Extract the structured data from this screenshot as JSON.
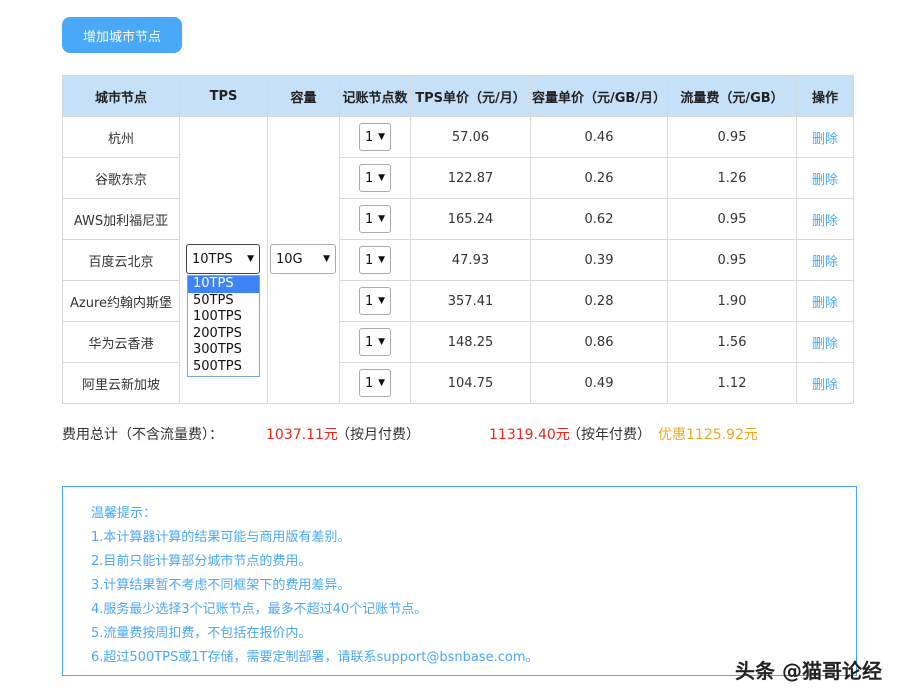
{
  "add_button": "增加城市节点",
  "table": {
    "headers": [
      "城市节点",
      "TPS",
      "容量",
      "记账节点数",
      "TPS单价（元/月）",
      "容量单价（元/GB/月）",
      "流量费（元/GB）",
      "操作"
    ],
    "rows": [
      {
        "city": "杭州",
        "count": "1",
        "tps_price": "57.06",
        "cap_price": "0.46",
        "traffic": "0.95",
        "action": "删除"
      },
      {
        "city": "谷歌东京",
        "count": "1",
        "tps_price": "122.87",
        "cap_price": "0.26",
        "traffic": "1.26",
        "action": "删除"
      },
      {
        "city": "AWS加利福尼亚",
        "count": "1",
        "tps_price": "165.24",
        "cap_price": "0.62",
        "traffic": "0.95",
        "action": "删除"
      },
      {
        "city": "百度云北京",
        "count": "1",
        "tps_price": "47.93",
        "cap_price": "0.39",
        "traffic": "0.95",
        "action": "删除"
      },
      {
        "city": "Azure约翰内斯堡",
        "count": "1",
        "tps_price": "357.41",
        "cap_price": "0.28",
        "traffic": "1.90",
        "action": "删除"
      },
      {
        "city": "华为云香港",
        "count": "1",
        "tps_price": "148.25",
        "cap_price": "0.86",
        "traffic": "1.56",
        "action": "删除"
      },
      {
        "city": "阿里云新加坡",
        "count": "1",
        "tps_price": "104.75",
        "cap_price": "0.49",
        "traffic": "1.12",
        "action": "删除"
      }
    ]
  },
  "tps_select": {
    "value": "10TPS",
    "options": [
      "10TPS",
      "50TPS",
      "100TPS",
      "200TPS",
      "300TPS",
      "500TPS"
    ]
  },
  "capacity_select": {
    "value": "10G"
  },
  "summary": {
    "label": "费用总计（不含流量费）：",
    "monthly_amount": "1037.11元",
    "monthly_note": "（按月付费）",
    "yearly_amount": "11319.40元",
    "yearly_note": "（按年付费）",
    "discount": "优惠1125.92元"
  },
  "tips": {
    "title": "温馨提示：",
    "items": [
      "1.本计算器计算的结果可能与商用版有差别。",
      "2.目前只能计算部分城市节点的费用。",
      "3.计算结果暂不考虑不同框架下的费用差异。",
      "4.服务最少选择3个记账节点，最多不超过40个记账节点。",
      "5.流量费按周扣费，不包括在报价内。",
      "6.超过500TPS或1T存储，需要定制部署，请联系support@bsnbase.com。"
    ]
  },
  "watermark": "头条 @猫哥论经",
  "colors": {
    "accent": "#4aa8f8",
    "header_bg": "#c6e0f8",
    "price_red": "#e8291b",
    "discount_orange": "#f0a81e"
  }
}
